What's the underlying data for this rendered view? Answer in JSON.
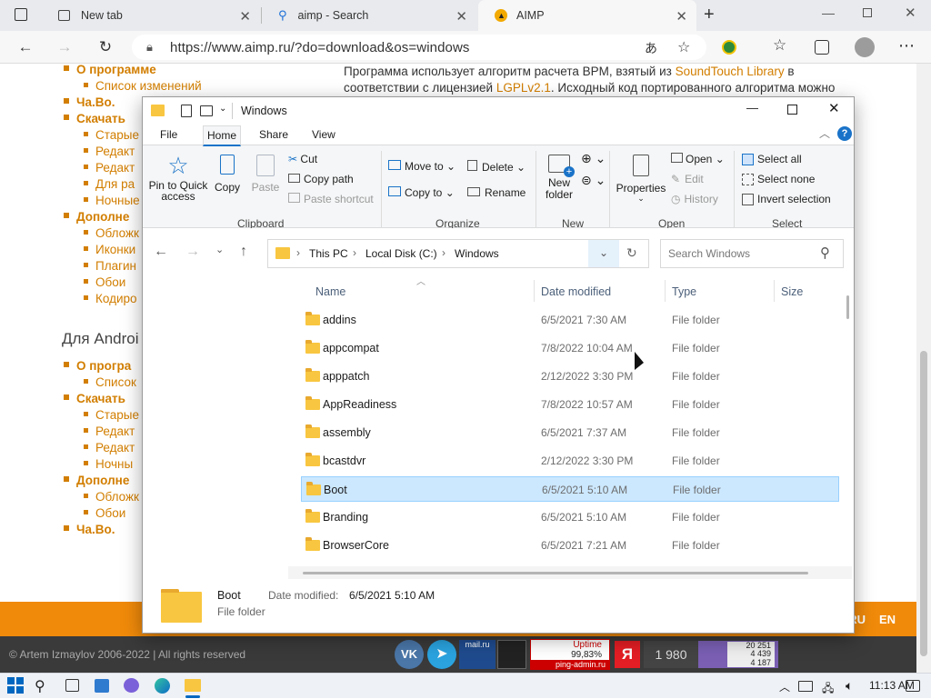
{
  "browser": {
    "tabs": [
      {
        "label": "New tab",
        "icon": "new-tab-icon"
      },
      {
        "label": "aimp - Search",
        "icon": "search-icon"
      },
      {
        "label": "AIMP",
        "icon": "aimp-icon"
      }
    ],
    "url": "https://www.aimp.ru/?do=download&os=windows"
  },
  "page": {
    "menu_top": [
      {
        "label": "О программе",
        "level": 1
      },
      {
        "label": "Список изменений",
        "level": 2
      },
      {
        "label": "Ча.Во.",
        "level": 1
      },
      {
        "label": "Скачать",
        "level": 1
      },
      {
        "label": "Старые",
        "level": 2
      },
      {
        "label": "Редакт",
        "level": 2
      },
      {
        "label": "Редакт",
        "level": 2
      },
      {
        "label": "Для ра",
        "level": 2
      },
      {
        "label": "Ночные",
        "level": 2
      },
      {
        "label": "Дополне",
        "level": 1
      },
      {
        "label": "Обложк",
        "level": 2
      },
      {
        "label": "Иконки",
        "level": 2
      },
      {
        "label": "Плагин",
        "level": 2
      },
      {
        "label": "Обои",
        "level": 2
      },
      {
        "label": "Кодиро",
        "level": 2
      }
    ],
    "android_heading": "Для Androi",
    "menu_android": [
      {
        "label": "О програ",
        "level": 1
      },
      {
        "label": "Список",
        "level": 2
      },
      {
        "label": "Скачать",
        "level": 1
      },
      {
        "label": "Старые",
        "level": 2
      },
      {
        "label": "Редакт",
        "level": 2
      },
      {
        "label": "Редакт",
        "level": 2
      },
      {
        "label": "Ночны",
        "level": 2
      },
      {
        "label": "Дополне",
        "level": 1
      },
      {
        "label": "Обложк",
        "level": 2
      },
      {
        "label": "Обои",
        "level": 2
      },
      {
        "label": "Ча.Во.",
        "level": 1
      }
    ],
    "text_line1_pre": "Программа использует алгоритм расчета BPM, взятый из ",
    "text_link1": "SoundTouch Library",
    "text_line1_post": " в",
    "text_line2_pre": "соответствии с лицензией ",
    "text_link2": "LGPLv2.1",
    "text_line2_post": ". Исходный код портированного алгоритма можно",
    "lang_ru": "RU",
    "lang_en": "EN",
    "copyright": "© Artem Izmaylov 2006-2022 | All rights reserved",
    "badges": {
      "uptime_label": "Uptime",
      "uptime_value": "99,83%",
      "uptime_site": "ping-admin.ru",
      "yandex_count": "1 980",
      "stats": [
        "20 251",
        "4 439",
        "4 187"
      ],
      "mailru": "mail.ru"
    }
  },
  "explorer": {
    "title": "Windows",
    "tabs": [
      "File",
      "Home",
      "Share",
      "View"
    ],
    "active_tab": "Home",
    "clipboard": {
      "pin": "Pin to Quick access",
      "copy": "Copy",
      "paste": "Paste",
      "cut": "Cut",
      "copy_path": "Copy path",
      "paste_shortcut": "Paste shortcut",
      "group": "Clipboard"
    },
    "organize": {
      "move_to": "Move to",
      "copy_to": "Copy to",
      "delete": "Delete",
      "rename": "Rename",
      "group": "Organize"
    },
    "new": {
      "new_folder": "New folder",
      "group": "New"
    },
    "open": {
      "properties": "Properties",
      "open": "Open",
      "edit": "Edit",
      "history": "History",
      "group": "Open"
    },
    "select": {
      "select_all": "Select all",
      "select_none": "Select none",
      "invert": "Invert selection",
      "group": "Select"
    },
    "breadcrumb": [
      "This PC",
      "Local Disk (C:)",
      "Windows"
    ],
    "search_placeholder": "Search Windows",
    "columns": [
      "Name",
      "Date modified",
      "Type",
      "Size"
    ],
    "rows": [
      {
        "name": "addins",
        "date": "6/5/2021 7:30 AM",
        "type": "File folder"
      },
      {
        "name": "appcompat",
        "date": "7/8/2022 10:04 AM",
        "type": "File folder"
      },
      {
        "name": "apppatch",
        "date": "2/12/2022 3:30 PM",
        "type": "File folder"
      },
      {
        "name": "AppReadiness",
        "date": "7/8/2022 10:57 AM",
        "type": "File folder"
      },
      {
        "name": "assembly",
        "date": "6/5/2021 7:37 AM",
        "type": "File folder"
      },
      {
        "name": "bcastdvr",
        "date": "2/12/2022 3:30 PM",
        "type": "File folder"
      },
      {
        "name": "Boot",
        "date": "6/5/2021 5:10 AM",
        "type": "File folder",
        "selected": true
      },
      {
        "name": "Branding",
        "date": "6/5/2021 5:10 AM",
        "type": "File folder"
      },
      {
        "name": "BrowserCore",
        "date": "6/5/2021 7:21 AM",
        "type": "File folder"
      }
    ],
    "details": {
      "name": "Boot",
      "type": "File folder",
      "date_label": "Date modified:",
      "date": "6/5/2021 5:10 AM"
    }
  },
  "taskbar": {
    "time": "11:13 AM"
  },
  "colors": {
    "accent_orange": "#d27e00",
    "footer": "#f08a0a",
    "selection": "#cce8ff"
  }
}
